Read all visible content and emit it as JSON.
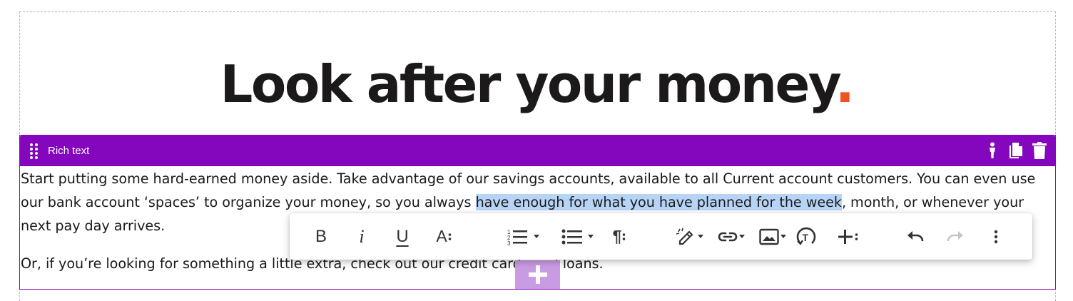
{
  "page": {
    "title_text": "Look after your money",
    "title_dot": ".",
    "accent_color": "#f05323"
  },
  "block": {
    "label": "Rich text",
    "header_color": "#8406bd",
    "actions": [
      "person-icon",
      "copy-icon",
      "trash-icon"
    ]
  },
  "content": {
    "p1_before": "Start putting some hard-earned money aside. Take advantage of our savings accounts, available to all Current account customers. You can even use our bank account ‘spaces’ to organize your money, so you always ",
    "p1_selected": "have enough for what you have planned for the week",
    "p1_after": ", month, or whenever your next pay day arrives.",
    "p2": "Or, if you’re looking for something a little extra, check out our credit cards and loans."
  },
  "toolbar": {
    "buttons": [
      {
        "name": "bold",
        "label": "B"
      },
      {
        "name": "italic",
        "label": "i"
      },
      {
        "name": "underline",
        "label": "U"
      },
      {
        "name": "text-style",
        "label": "A"
      },
      {
        "name": "numbered-list"
      },
      {
        "name": "bulleted-list"
      },
      {
        "name": "paragraph-format",
        "label": "¶"
      },
      {
        "name": "highlight"
      },
      {
        "name": "link"
      },
      {
        "name": "image"
      },
      {
        "name": "clear-formatting"
      },
      {
        "name": "insert"
      },
      {
        "name": "undo"
      },
      {
        "name": "redo",
        "disabled": true
      },
      {
        "name": "more"
      }
    ]
  }
}
